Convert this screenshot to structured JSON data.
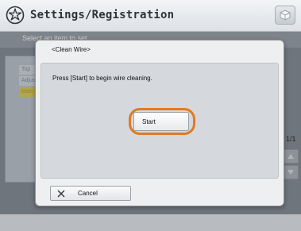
{
  "header": {
    "title": "Settings/Registration",
    "app_icon": "settings-gear-icon",
    "home_icon": "home-cube-icon"
  },
  "background": {
    "instruction": "Select an item to set.",
    "list_items": [
      "Top",
      "Adjus",
      "Main"
    ],
    "page_indicator": "1/1",
    "scroll_up_icon": "triangle-up-icon",
    "scroll_down_icon": "triangle-down-icon"
  },
  "dialog": {
    "title": "<Clean Wire>",
    "message": "Press [Start] to begin wire cleaning.",
    "start_label": "Start",
    "cancel_label": "Cancel",
    "cancel_icon": "x-close-icon"
  },
  "colors": {
    "highlight": "#e07a23",
    "selected_item": "#b2a54a"
  }
}
